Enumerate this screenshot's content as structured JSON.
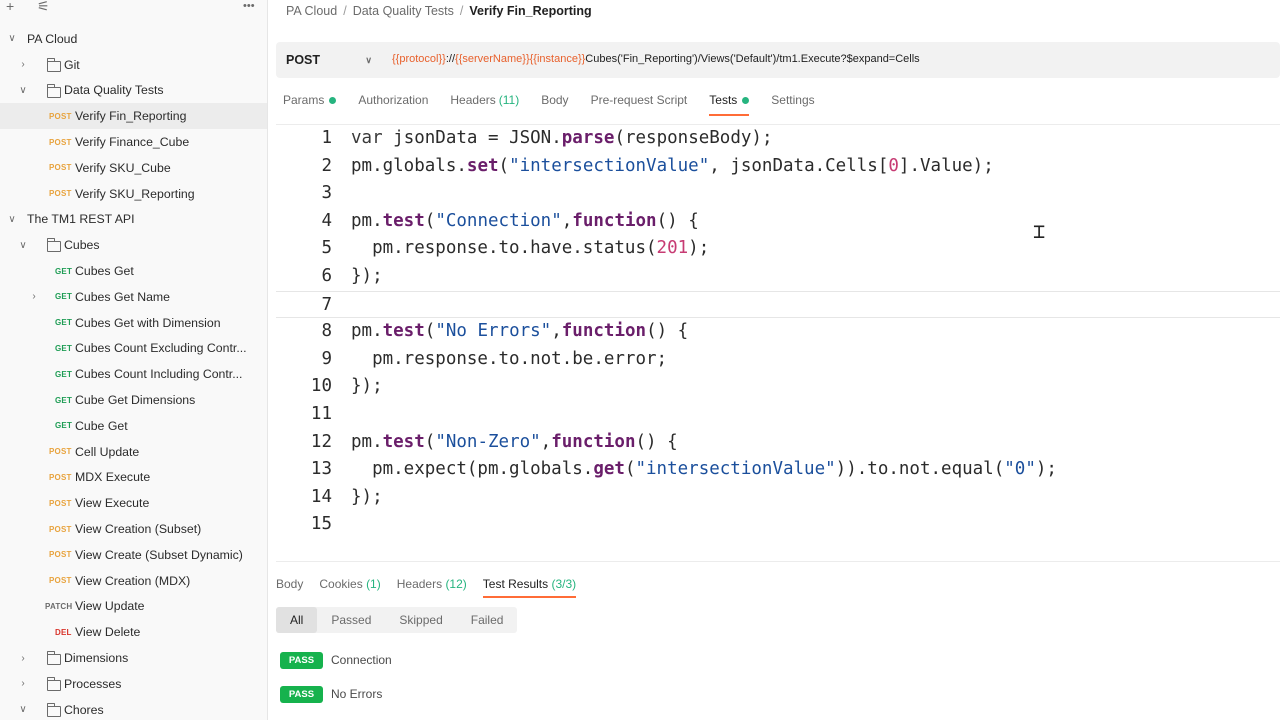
{
  "sidebar": {
    "toolbar": {
      "add": "+",
      "filter": "⚟",
      "more": "•••"
    },
    "tree": [
      {
        "type": "collection",
        "label": "PA Cloud",
        "chev": "v"
      },
      {
        "type": "folder",
        "label": "Git",
        "chev": ">"
      },
      {
        "type": "folder",
        "label": "Data Quality Tests",
        "chev": "v"
      },
      {
        "type": "request",
        "method": "POST",
        "label": "Verify Fin_Reporting",
        "selected": true
      },
      {
        "type": "request",
        "method": "POST",
        "label": "Verify Finance_Cube"
      },
      {
        "type": "request",
        "method": "POST",
        "label": "Verify SKU_Cube"
      },
      {
        "type": "request",
        "method": "POST",
        "label": "Verify SKU_Reporting"
      },
      {
        "type": "collection",
        "label": "The TM1 REST API",
        "chev": "v"
      },
      {
        "type": "folder",
        "label": "Cubes",
        "chev": "v"
      },
      {
        "type": "request",
        "method": "GET",
        "label": "Cubes Get"
      },
      {
        "type": "request",
        "method": "GET",
        "label": "Cubes Get Name",
        "chev": ">"
      },
      {
        "type": "request",
        "method": "GET",
        "label": "Cubes Get with Dimension"
      },
      {
        "type": "request",
        "method": "GET",
        "label": "Cubes Count Excluding Contr..."
      },
      {
        "type": "request",
        "method": "GET",
        "label": "Cubes Count Including Contr..."
      },
      {
        "type": "request",
        "method": "GET",
        "label": "Cube Get Dimensions"
      },
      {
        "type": "request",
        "method": "GET",
        "label": "Cube Get"
      },
      {
        "type": "request",
        "method": "POST",
        "label": "Cell Update"
      },
      {
        "type": "request",
        "method": "POST",
        "label": "MDX Execute"
      },
      {
        "type": "request",
        "method": "POST",
        "label": "View Execute"
      },
      {
        "type": "request",
        "method": "POST",
        "label": "View Creation (Subset)"
      },
      {
        "type": "request",
        "method": "POST",
        "label": "View Create (Subset Dynamic)"
      },
      {
        "type": "request",
        "method": "POST",
        "label": "View Creation (MDX)"
      },
      {
        "type": "request",
        "method": "PATCH",
        "label": "View Update"
      },
      {
        "type": "request",
        "method": "DEL",
        "label": "View Delete"
      },
      {
        "type": "folder",
        "label": "Dimensions",
        "chev": ">"
      },
      {
        "type": "folder",
        "label": "Processes",
        "chev": ">"
      },
      {
        "type": "folder",
        "label": "Chores",
        "chev": "v"
      }
    ]
  },
  "breadcrumb": {
    "part1": "PA Cloud",
    "part2": "Data Quality Tests",
    "current": "Verify Fin_Reporting",
    "sep": "/"
  },
  "request": {
    "method": "POST",
    "url": {
      "protocol": "{{protocol}}",
      "sep1": "://",
      "serverName": "{{serverName}}",
      "instance": "{{instance}}",
      "rest": "Cubes('Fin_Reporting')/Views('Default')/tm1.Execute?$expand=Cells"
    }
  },
  "request_tabs": [
    {
      "label": "Params",
      "dot": true
    },
    {
      "label": "Authorization"
    },
    {
      "label": "Headers",
      "count": "(11)"
    },
    {
      "label": "Body"
    },
    {
      "label": "Pre-request Script"
    },
    {
      "label": "Tests",
      "dot": true,
      "active": true
    },
    {
      "label": "Settings"
    }
  ],
  "code_lines": [
    [
      [
        "kw",
        "var "
      ],
      [
        "obj",
        "jsonData "
      ],
      [
        "obj",
        "= "
      ],
      [
        "obj",
        "JSON"
      ],
      [
        "obj",
        "."
      ],
      [
        "fn",
        "parse"
      ],
      [
        "obj",
        "(responseBody);"
      ]
    ],
    [
      [
        "obj",
        "pm.globals."
      ],
      [
        "fn",
        "set"
      ],
      [
        "obj",
        "("
      ],
      [
        "str",
        "\"intersectionValue\""
      ],
      [
        "obj",
        ", jsonData.Cells["
      ],
      [
        "num",
        "0"
      ],
      [
        "obj",
        "].Value);"
      ]
    ],
    [],
    [
      [
        "obj",
        "pm."
      ],
      [
        "fn",
        "test"
      ],
      [
        "obj",
        "("
      ],
      [
        "str",
        "\"Connection\""
      ],
      [
        "obj",
        ","
      ],
      [
        "fn",
        "function"
      ],
      [
        "obj",
        "() {"
      ]
    ],
    [
      [
        "obj",
        "  pm.response.to.have.status("
      ],
      [
        "num",
        "201"
      ],
      [
        "obj",
        ");"
      ]
    ],
    [
      [
        "obj",
        "});"
      ]
    ],
    [],
    [
      [
        "obj",
        "pm."
      ],
      [
        "fn",
        "test"
      ],
      [
        "obj",
        "("
      ],
      [
        "str",
        "\"No Errors\""
      ],
      [
        "obj",
        ","
      ],
      [
        "fn",
        "function"
      ],
      [
        "obj",
        "() {"
      ]
    ],
    [
      [
        "obj",
        "  pm.response.to.not.be.error;"
      ]
    ],
    [
      [
        "obj",
        "});"
      ]
    ],
    [],
    [
      [
        "obj",
        "pm."
      ],
      [
        "fn",
        "test"
      ],
      [
        "obj",
        "("
      ],
      [
        "str",
        "\"Non-Zero\""
      ],
      [
        "obj",
        ","
      ],
      [
        "fn",
        "function"
      ],
      [
        "obj",
        "() {"
      ]
    ],
    [
      [
        "obj",
        "  pm.expect(pm.globals."
      ],
      [
        "fn",
        "get"
      ],
      [
        "obj",
        "("
      ],
      [
        "str",
        "\"intersectionValue\""
      ],
      [
        "obj",
        ")).to.not.equal("
      ],
      [
        "str",
        "\"0\""
      ],
      [
        "obj",
        ");"
      ]
    ],
    [
      [
        "obj",
        "});"
      ]
    ],
    []
  ],
  "cursor_icon": "text-cursor-icon",
  "response_tabs": [
    {
      "label": "Body"
    },
    {
      "label": "Cookies",
      "count": "(1)"
    },
    {
      "label": "Headers",
      "count": "(12)"
    },
    {
      "label": "Test Results",
      "count": "(3/3)",
      "active": true
    }
  ],
  "filters": [
    {
      "label": "All",
      "active": true
    },
    {
      "label": "Passed"
    },
    {
      "label": "Skipped"
    },
    {
      "label": "Failed"
    }
  ],
  "results": [
    {
      "status": "PASS",
      "name": "Connection"
    },
    {
      "status": "PASS",
      "name": "No Errors"
    }
  ],
  "colors": {
    "accent": "#ff6c37",
    "pass": "#16b24d",
    "post": "#e8a33d",
    "get": "#1f9d55",
    "delete": "#d9342b",
    "variable": "#e8612d"
  }
}
